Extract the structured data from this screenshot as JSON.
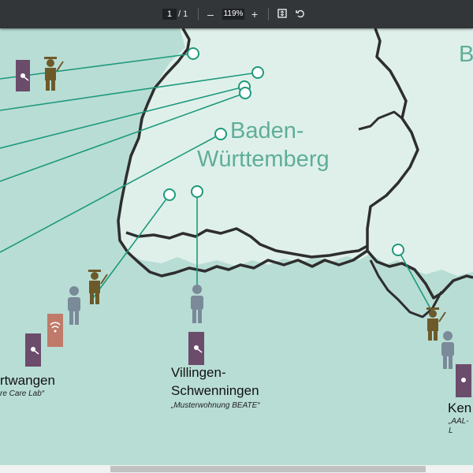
{
  "toolbar": {
    "page_current": "1",
    "page_total": "/ 1",
    "zoom_out_label": "–",
    "zoom_level": "119%",
    "zoom_in_label": "+",
    "fit_icon": "fit-page-icon",
    "rotate_icon": "rotate-icon"
  },
  "map": {
    "state_name_line1": "Baden-",
    "state_name_line2": "Württemberg",
    "right_edge_letter": "B",
    "locations": [
      {
        "name_line1": "rtwangen",
        "subtitle": "re Care Lab“"
      },
      {
        "name_line1": "Villingen-",
        "name_line2": "Schwenningen",
        "subtitle": "„Musterwohnung BEATE“"
      },
      {
        "name_line1": "Ken",
        "subtitle": "„AAL-L"
      }
    ]
  },
  "colors": {
    "sea": "#b8ddd5",
    "land": "#dff0ea",
    "line": "#1e9a7c",
    "border": "#2e2e2e",
    "door": "#6b4c6b",
    "person": "#7a8a99",
    "graduate": "#6d5a2a",
    "wifi_door": "#c07a6a"
  }
}
